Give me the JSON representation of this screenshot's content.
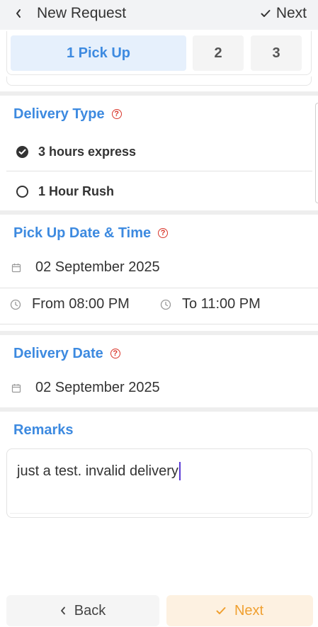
{
  "header": {
    "title": "New Request",
    "next_label": "Next"
  },
  "steps": [
    {
      "label": "1 Pick Up",
      "active": true
    },
    {
      "label": "2",
      "active": false
    },
    {
      "label": "3",
      "active": false
    }
  ],
  "delivery_type": {
    "title": "Delivery Type",
    "options": [
      {
        "label": "3 hours express",
        "selected": true
      },
      {
        "label": "1 Hour Rush",
        "selected": false
      }
    ]
  },
  "pickup": {
    "title": "Pick Up Date & Time",
    "date": "02 September 2025",
    "from": "From 08:00 PM",
    "to": "To 11:00 PM"
  },
  "delivery_date": {
    "title": "Delivery Date",
    "date": "02 September 2025"
  },
  "remarks": {
    "title": "Remarks",
    "value": "just a test. invalid delivery"
  },
  "footer": {
    "back_label": "Back",
    "next_label": "Next"
  },
  "colors": {
    "accent_blue": "#3d8ae0",
    "help_red": "#d9362b",
    "next_orange": "#f0a030",
    "next_bg": "#fdf1e1",
    "caret": "#5b3bd6"
  },
  "icons": {
    "back": "chevron-left-icon",
    "check": "checkmark-icon",
    "help": "question-circle-icon",
    "calendar": "calendar-icon",
    "clock": "clock-icon"
  }
}
